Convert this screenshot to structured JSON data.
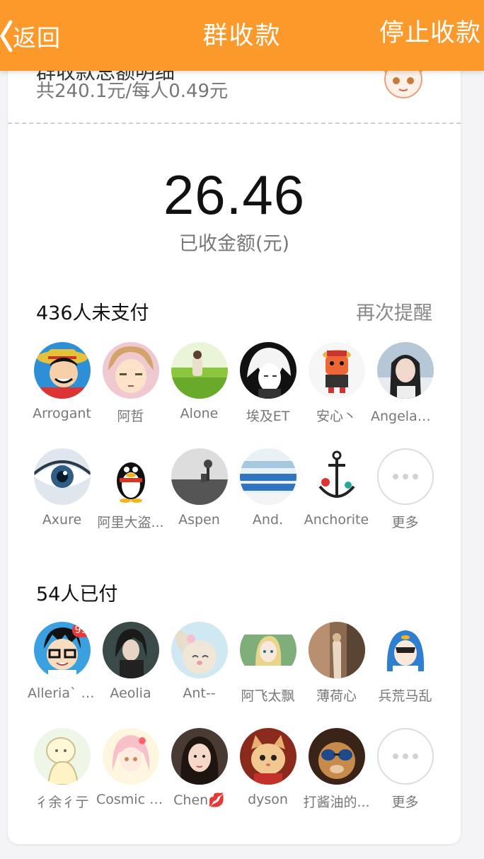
{
  "header": {
    "back_label": "返回",
    "title": "群收款",
    "stop_label": "停止收款",
    "bg_color": "#fb9a2b"
  },
  "summary": {
    "cutoff_title": "群收款总额明细",
    "subtitle": "共240.1元/每人0.49元",
    "amount": "26.46",
    "amount_label": "已收金额(元)"
  },
  "unpaid": {
    "heading": "436人未支付",
    "remind_label": "再次提醒",
    "members": [
      {
        "name": "Arrogant",
        "icon": "luffy-avatar"
      },
      {
        "name": "阿哲",
        "icon": "anime-boy-avatar"
      },
      {
        "name": "Alone",
        "icon": "field-avatar"
      },
      {
        "name": "埃及ET",
        "icon": "white-hair-avatar"
      },
      {
        "name": "安心丶",
        "icon": "chibi-avatar"
      },
      {
        "name": "Angelaい...",
        "icon": "girl-photo-avatar"
      },
      {
        "name": "Axure",
        "icon": "eye-avatar"
      },
      {
        "name": "阿里大盗...",
        "icon": "qq-penguin-avatar"
      },
      {
        "name": "Aspen",
        "icon": "gray-landscape-avatar"
      },
      {
        "name": "And.",
        "icon": "stadium-avatar"
      },
      {
        "name": "Anchorite",
        "icon": "anchor-avatar"
      },
      {
        "name": "更多",
        "icon": "more-icon"
      }
    ]
  },
  "paid": {
    "heading": "54人已付",
    "members": [
      {
        "name": "Alleria` W...",
        "icon": "glasses-boy-avatar",
        "badge": "99"
      },
      {
        "name": "Aeolia",
        "icon": "dark-anime-avatar"
      },
      {
        "name": "Ant--",
        "icon": "bunny-avatar"
      },
      {
        "name": "阿飞太飘",
        "icon": "anime-girl-avatar"
      },
      {
        "name": "薄荷心",
        "icon": "street-photo-avatar"
      },
      {
        "name": "兵荒马乱",
        "icon": "penguin-hood-avatar"
      },
      {
        "name": "彳余彳亍",
        "icon": "sketch-avatar"
      },
      {
        "name": "Cosmic A...",
        "icon": "pink-anime-avatar"
      },
      {
        "name": "Chen💋",
        "icon": "girl-portrait-avatar"
      },
      {
        "name": "dyson",
        "icon": "cat-avatar"
      },
      {
        "name": "打酱油的...",
        "icon": "sunglasses-avatar"
      },
      {
        "name": "更多",
        "icon": "more-icon"
      }
    ]
  }
}
